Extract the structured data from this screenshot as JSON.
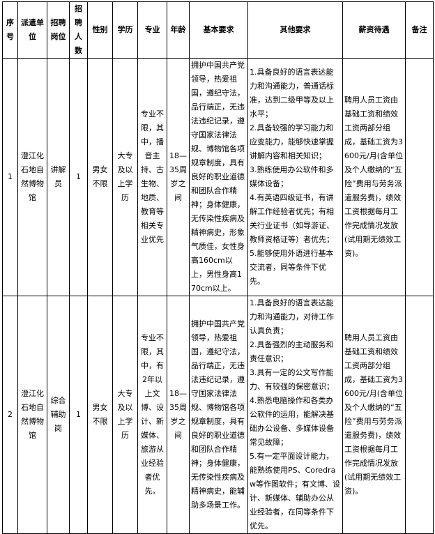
{
  "headers": {
    "seq": "序号",
    "unit": "派遣单位",
    "post": "招聘岗位",
    "count": "招聘人数",
    "gender": "性别",
    "edu": "学历",
    "major": "专业",
    "age": "年龄",
    "basic": "基本要求",
    "other": "其他要求",
    "salary": "薪资待遇",
    "note": "备注"
  },
  "rows": [
    {
      "seq": "1",
      "unit": "澄江化石地自然博物馆",
      "post": "讲解员",
      "count": "1",
      "gender": "男女不限",
      "edu": "大专及以上学历",
      "major": "专业不限，其中，播音主持、古生物、地质、教育等相关专业优先",
      "age": "18—35周岁之间",
      "basic": "拥护中国共产党领导，热爱祖国，遵纪守法，品行端正，无违法违纪记录，遵守国家法律法规、博物馆各项规章制度，具有良好的职业道德和团队合作精神；身体健康，无传染性疾病及精神病史，形象气质佳，女性身高160cm以上，男性身高170cm以上。",
      "other": [
        "1.具备良好的语言表达能力和沟通能力，普通话标准，达到二级甲等及以上水平；",
        "2.具备较强的学习能力和应变能力，能够快速掌握讲解内容和相关知识；",
        "3.熟练使用办公软件和多媒体设备；",
        "4.有英语四级证书，有讲解工作经验者优先；有相关行业证书（如导游证、教师资格证等）者优先；",
        "5.能够使用外语进行基本交流者，同等条件下优先。"
      ],
      "salary": "聘用人员工资由基础工资和绩效工资两部分组成，基础工资为3600元/月(含单位及个人缴纳的“五险”费用与劳务派遣服务费)，绩效工资根据每月工作完成情况发放(试用期无绩效工资)。",
      "note": ""
    },
    {
      "seq": "2",
      "unit": "澄江化石地自然博物馆",
      "post": "综合辅助岗",
      "count": "1",
      "gender": "男女不限",
      "edu": "大专及以上学历",
      "major": "专业不限，其中，有2年以上文博、设计、新媒体、旅游从业经验者优先。",
      "age": "18—35周岁之间",
      "basic": "拥护中国共产党领导，热爱祖国，遵纪守法，品行端正，无违法违纪记录，遵守国家法律法规、博物馆各项规章制度，具有良好的职业道德和团队合作精神；身体健康，无传染性疾病及精神病史，能辅助多场景工作。",
      "other": [
        "1.具备良好的语言表达能力和沟通能力，对待工作认真负责；",
        "2.具备强烈的主动服务和责任意识；",
        "3.具有一定的公文写作能力、有较强的保密意识；",
        "4.熟悉电脑操作和各类办公软件的运用，能解决基础办公设备、多媒体设备常见故障；",
        "5.有一定平面设计能力，能熟练使用PS、Coredraw等作图软件；有文博、设计、新媒体、辅助办公从业经验者，在同等条件下优先。"
      ],
      "salary": "聘用人员工资由基础工资和绩效工资两部分组成，基础工资为3600元/月(含单位及个人缴纳的“五险”费用与劳务派遣服务费)，绩效工资根据每月工作完成情况发放(试用期无绩效工资)。",
      "note": ""
    }
  ]
}
